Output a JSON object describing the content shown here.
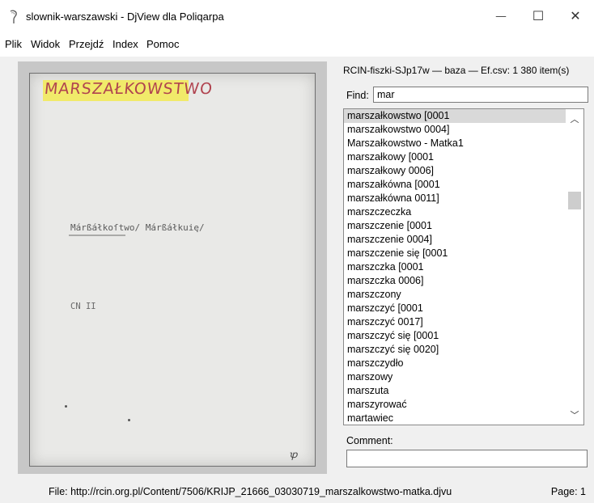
{
  "window": {
    "title": "slownik-warszawski - DjView dla Poliqarpa",
    "minimize_glyph": "—",
    "maximize_glyph": "☐",
    "close_glyph": "✕"
  },
  "menu": [
    "Plik",
    "Widok",
    "Przejdź",
    "Index",
    "Pomoc"
  ],
  "card": {
    "handwritten": "MARSZAŁKOWSTWO",
    "typed_headword": "Márßáłkoſtwo/ Márßáłkuię/",
    "typed_source": "CN II",
    "corner_mark": "ꝕ"
  },
  "panel": {
    "header": "RCIN-fiszki-SJp17w — baza — Ef.csv: 1 380 item(s)",
    "find_label": "Find:",
    "find_value": "mar",
    "items": [
      "marszałkowstwo [0001",
      "marszałkowstwo 0004]",
      "Marszałkowstwo - Matka1",
      "marszałkowy [0001",
      "marszałkowy 0006]",
      "marszałkówna [0001",
      "marszałkówna 0011]",
      "marszczeczka",
      "marszczenie [0001",
      "marszczenie 0004]",
      "marszczenie się [0001",
      "marszczka [0001",
      "marszczka 0006]",
      "marszczony",
      "marszczyć [0001",
      "marszczyć 0017]",
      "marszczyć się [0001",
      "marszczyć się 0020]",
      "marszczydło",
      "marszowy",
      "marszuta",
      "marszyrować",
      "martawiec"
    ],
    "selected_index": 0,
    "comment_label": "Comment:",
    "comment_value": ""
  },
  "status": {
    "file": "File: http://rcin.org.pl/Content/7506/KRIJP_21666_03030719_marszalkowstwo-matka.djvu",
    "page": "Page: 1"
  },
  "colors": {
    "highlight": "#f1ea6a",
    "handwriting": "#b0434f"
  }
}
